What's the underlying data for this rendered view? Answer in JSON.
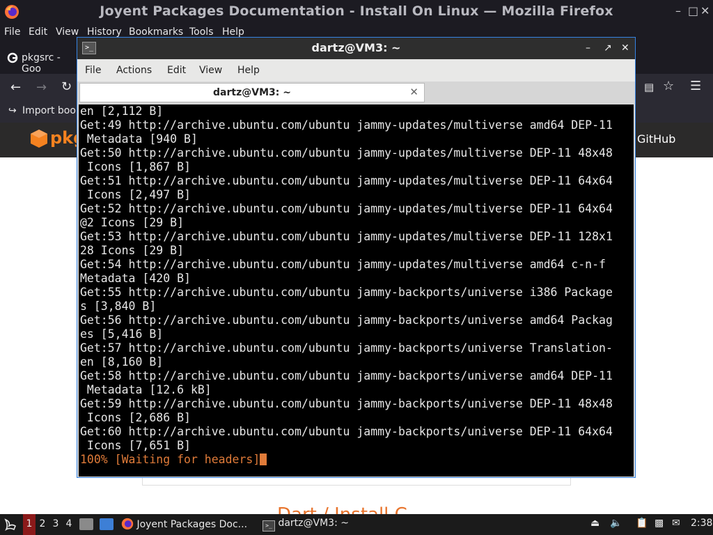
{
  "firefox": {
    "window_title": "Joyent Packages Documentation - Install On Linux — Mozilla Firefox",
    "menu": [
      "File",
      "Edit",
      "View",
      "History",
      "Bookmarks",
      "Tools",
      "Help"
    ],
    "tab_label": "pkgsrc - Goo",
    "bookmarks_label": "Import book",
    "site_header": {
      "logo_text": "pkg",
      "github_link": "GitHub"
    },
    "page_heading_fragment": "Dart / Install C"
  },
  "terminal": {
    "window_title": "dartz@VM3: ~",
    "menu": [
      "File",
      "Actions",
      "Edit",
      "View",
      "Help"
    ],
    "tab_label": "dartz@VM3: ~",
    "lines": [
      "en [2,112 B]",
      "Get:49 http://archive.ubuntu.com/ubuntu jammy-updates/multiverse amd64 DEP-11",
      " Metadata [940 B]",
      "Get:50 http://archive.ubuntu.com/ubuntu jammy-updates/multiverse DEP-11 48x48",
      " Icons [1,867 B]",
      "Get:51 http://archive.ubuntu.com/ubuntu jammy-updates/multiverse DEP-11 64x64",
      " Icons [2,497 B]",
      "Get:52 http://archive.ubuntu.com/ubuntu jammy-updates/multiverse DEP-11 64x64",
      "@2 Icons [29 B]",
      "Get:53 http://archive.ubuntu.com/ubuntu jammy-updates/multiverse DEP-11 128x1",
      "28 Icons [29 B]",
      "Get:54 http://archive.ubuntu.com/ubuntu jammy-updates/multiverse amd64 c-n-f",
      "Metadata [420 B]",
      "Get:55 http://archive.ubuntu.com/ubuntu jammy-backports/universe i386 Package",
      "s [3,840 B]",
      "Get:56 http://archive.ubuntu.com/ubuntu jammy-backports/universe amd64 Packag",
      "es [5,416 B]",
      "Get:57 http://archive.ubuntu.com/ubuntu jammy-backports/universe Translation-",
      "en [8,160 B]",
      "Get:58 http://archive.ubuntu.com/ubuntu jammy-backports/universe amd64 DEP-11",
      " Metadata [12.6 kB]",
      "Get:59 http://archive.ubuntu.com/ubuntu jammy-backports/universe DEP-11 48x48",
      " Icons [2,686 B]",
      "Get:60 http://archive.ubuntu.com/ubuntu jammy-backports/universe DEP-11 64x64",
      " Icons [7,651 B]"
    ],
    "status_line": "100% [Waiting for headers]"
  },
  "taskbar": {
    "workspaces": [
      "1",
      "2",
      "3",
      "4"
    ],
    "active_workspace": "1",
    "tasks": [
      {
        "label": "Joyent Packages Doc...",
        "icon": "firefox-icon"
      },
      {
        "label": "dartz@VM3: ~",
        "icon": "terminal-icon"
      }
    ],
    "clock": "2:38"
  },
  "colors": {
    "terminal_bg": "#000000",
    "terminal_fg": "#e6e6e6",
    "terminal_status": "#e07b39",
    "accent_border": "#3584e4",
    "active_workspace": "#8b1a1a"
  }
}
